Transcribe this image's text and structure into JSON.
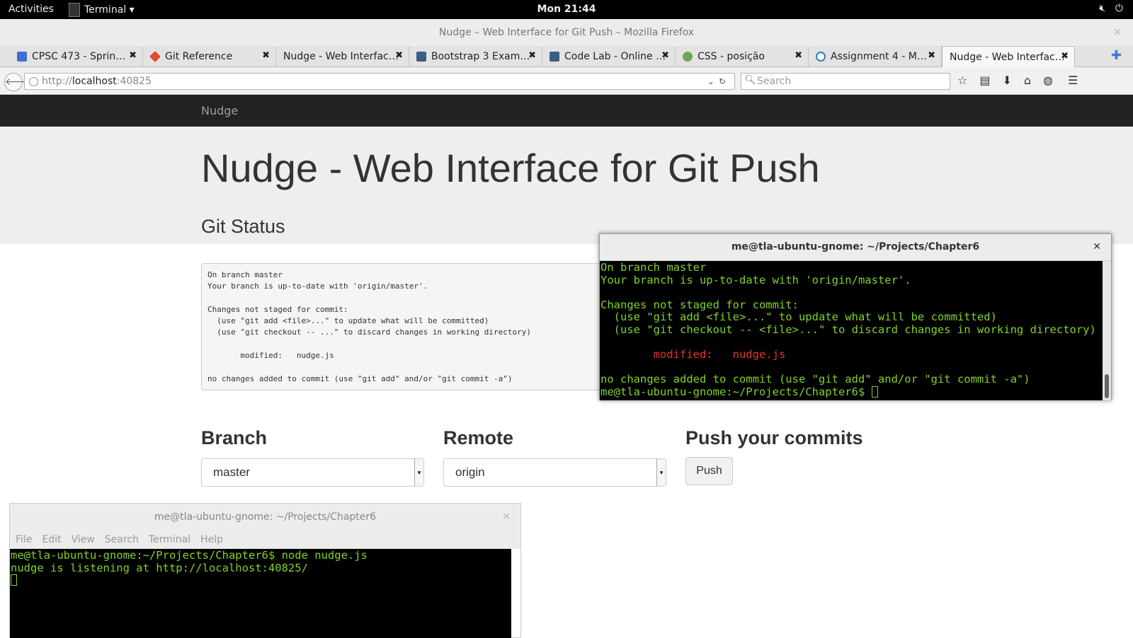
{
  "topbar": {
    "activities": "Activities",
    "app_name": "Terminal ▾",
    "clock": "Mon 21:44",
    "tray_icons": [
      "speaker-muted-icon",
      "power-icon"
    ]
  },
  "firefox": {
    "window_title": "Nudge – Web Interface for Git Push – Mozilla Firefox",
    "tabs": [
      {
        "label": "CPSC 473 - Sprin…",
        "icon": "google-docs-icon",
        "color": "#3f6fd8"
      },
      {
        "label": "Git Reference",
        "icon": "git-icon",
        "color": "#e2472f"
      },
      {
        "label": "Nudge - Web Interfac…",
        "icon": "",
        "color": ""
      },
      {
        "label": "Bootstrap 3 Exam…",
        "icon": "tumblr-icon",
        "color": "#3b5e81"
      },
      {
        "label": "Code Lab - Online …",
        "icon": "tumblr-icon",
        "color": "#3b5e81"
      },
      {
        "label": "CSS - posição",
        "icon": "stackexchange-icon",
        "color": "#6ea650"
      },
      {
        "label": "Assignment 4 - M…",
        "icon": "chrome-like-icon",
        "color": "#2a7dc1"
      },
      {
        "label": "Nudge - Web Interfac…",
        "icon": "",
        "color": ""
      }
    ],
    "url_prefix": "http://",
    "url_host": "localhost",
    "url_suffix": ":40825",
    "search_placeholder": "Search"
  },
  "page": {
    "brand": "Nudge",
    "heading": "Nudge - Web Interface for Git Push",
    "status_heading": "Git Status",
    "status_text": "On branch master\nYour branch is up-to-date with 'origin/master'.\n\nChanges not staged for commit:\n  (use \"git add <file>...\" to update what will be committed)\n  (use \"git checkout -- ...\" to discard changes in working directory)\n\n       modified:   nudge.js\n\nno changes added to commit (use \"git add\" and/or \"git commit -a\")",
    "branch_label": "Branch",
    "branch_value": "master",
    "remote_label": "Remote",
    "remote_value": "origin",
    "push_label": "Push your commits",
    "push_button": "Push"
  },
  "terminal_right": {
    "title": "me@tla-ubuntu-gnome: ~/Projects/Chapter6",
    "lines": [
      "On branch master",
      "Your branch is up-to-date with 'origin/master'.",
      "",
      "Changes not staged for commit:",
      "  (use \"git add <file>...\" to update what will be committed)",
      "  (use \"git checkout -- <file>...\" to discard changes in working directory)",
      ""
    ],
    "modified_label": "        modified:   nudge.js",
    "lines_after": [
      "",
      "no changes added to commit (use \"git add\" and/or \"git commit -a\")"
    ],
    "prompt": "me@tla-ubuntu-gnome:~/Projects/Chapter6$ "
  },
  "terminal_left": {
    "title": "me@tla-ubuntu-gnome: ~/Projects/Chapter6",
    "menu": [
      "File",
      "Edit",
      "View",
      "Search",
      "Terminal",
      "Help"
    ],
    "lines": [
      "me@tla-ubuntu-gnome:~/Projects/Chapter6$ node nudge.js",
      "nudge is listening at http://localhost:40825/"
    ]
  },
  "colors": {
    "terminal_text": "#7fd32a",
    "terminal_red": "#e3352c",
    "navbar_bg": "#222222",
    "jumbotron_bg": "#eeeeee"
  }
}
